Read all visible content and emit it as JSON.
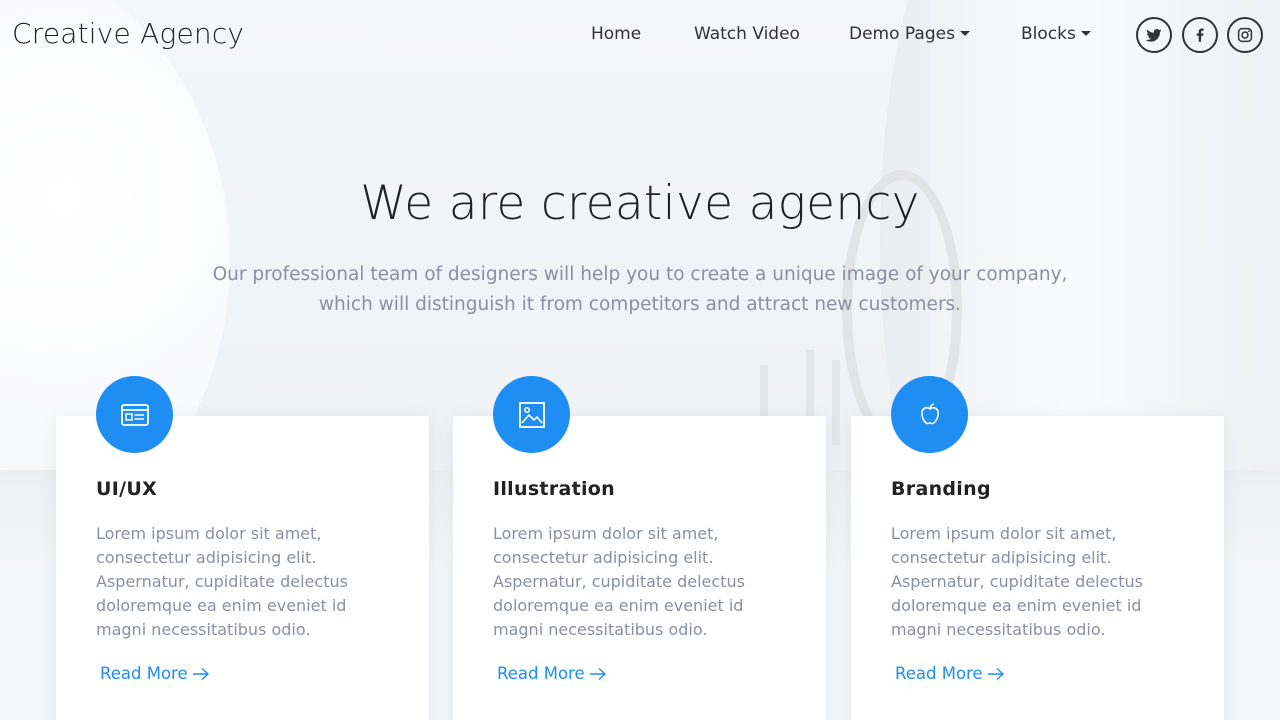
{
  "brand": "Creative Agency",
  "nav": {
    "items": [
      {
        "label": "Home",
        "dropdown": false
      },
      {
        "label": "Watch Video",
        "dropdown": false
      },
      {
        "label": "Demo Pages",
        "dropdown": true
      },
      {
        "label": "Blocks",
        "dropdown": true
      }
    ],
    "social": [
      {
        "icon": "twitter-icon"
      },
      {
        "icon": "facebook-icon"
      },
      {
        "icon": "instagram-icon"
      }
    ]
  },
  "hero": {
    "title": "We are creative agency",
    "subtitle_line1": "Our professional team of designers will help you to create a unique image of your company,",
    "subtitle_line2": "which will distinguish it from competitors and attract new customers."
  },
  "cards": [
    {
      "icon": "browser-window-icon",
      "title": "UI/UX",
      "text": "Lorem ipsum dolor sit amet, consectetur adipisicing elit. Aspernatur, cupiditate delectus doloremque ea enim eveniet id magni necessitatibus odio.",
      "link": "Read More"
    },
    {
      "icon": "image-icon",
      "title": "Illustration",
      "text": "Lorem ipsum dolor sit amet, consectetur adipisicing elit. Aspernatur, cupiditate delectus doloremque ea enim eveniet id magni necessitatibus odio.",
      "link": "Read More"
    },
    {
      "icon": "apple-icon",
      "title": "Branding",
      "text": "Lorem ipsum dolor sit amet, consectetur adipisicing elit. Aspernatur, cupiditate delectus doloremque ea enim eveniet id magni necessitatibus odio.",
      "link": "Read More"
    }
  ],
  "colors": {
    "accent": "#1e8ef2",
    "text_muted": "#8a8fa3",
    "heading": "#222222"
  }
}
